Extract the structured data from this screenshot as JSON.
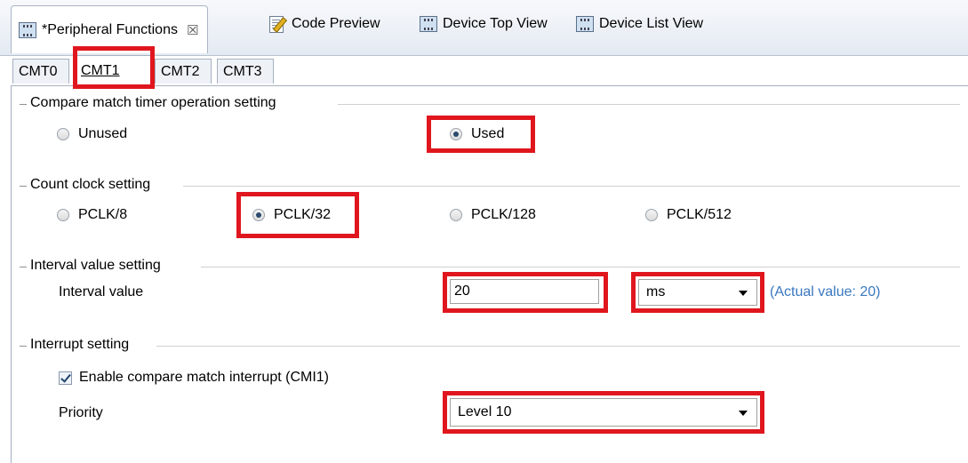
{
  "editor_tabs": [
    {
      "label": "*Peripheral Functions",
      "icon": "peripheral-functions-icon",
      "active": true
    },
    {
      "label": "Code Preview",
      "icon": "code-preview-icon"
    },
    {
      "label": "Device Top View",
      "icon": "device-top-view-icon"
    },
    {
      "label": "Device List View",
      "icon": "device-list-view-icon"
    }
  ],
  "close_glyph": "☒",
  "sub_tabs": [
    "CMT0",
    "CMT1",
    "CMT2",
    "CMT3"
  ],
  "selected_sub_tab": "CMT1",
  "operation": {
    "title": "Compare match timer operation setting",
    "options": [
      "Unused",
      "Used"
    ],
    "selected": "Used"
  },
  "count_clock": {
    "title": "Count clock setting",
    "options": [
      "PCLK/8",
      "PCLK/32",
      "PCLK/128",
      "PCLK/512"
    ],
    "selected": "PCLK/32"
  },
  "interval": {
    "title": "Interval value setting",
    "label": "Interval value",
    "value": "20",
    "unit": "ms",
    "actual": "(Actual value: 20)"
  },
  "interrupt": {
    "title": "Interrupt setting",
    "enable_label": "Enable compare match interrupt (CMI1)",
    "enabled": true,
    "priority_label": "Priority",
    "priority_value": "Level 10"
  },
  "colors": {
    "highlight": "#e0161e",
    "link_blue": "#3a78c0",
    "tab_bg": "#e4eaf2"
  }
}
